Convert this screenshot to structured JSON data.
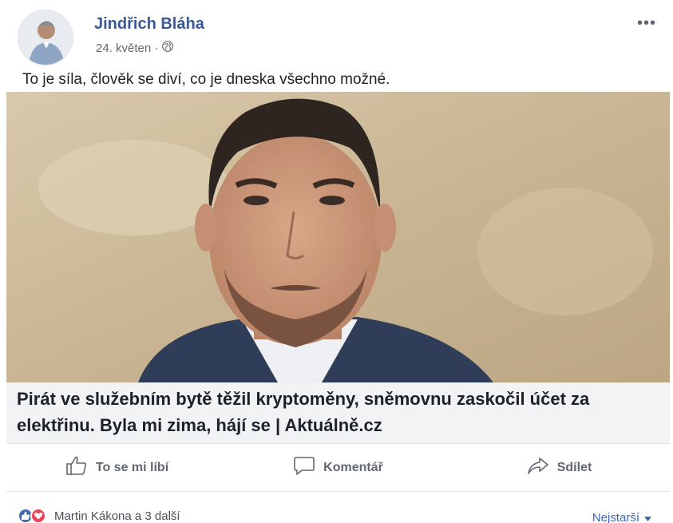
{
  "post": {
    "author": "Jindřich Bláha",
    "date": "24. květen ·",
    "privacy_icon": "globe-icon",
    "menu_label": "•••",
    "caption": "To je síla, člověk se diví, co je dneska všechno možné.",
    "link_title": "Pirát ve služebním bytě těžil kryptoměny, sněmovnu zaskočil účet za elektřinu. Byla mi zima, hájí se | Aktuálně.cz"
  },
  "actions": {
    "like_label": "To se mi líbí",
    "comment_label": "Komentář",
    "share_label": "Sdílet"
  },
  "footer": {
    "reactions_text": "Martin Kákona a 3 další",
    "sort_label": "Nejstarší"
  },
  "colors": {
    "link_blue": "#385898",
    "like_blue": "#4267b2",
    "love_red": "#f33e58",
    "link_box_bg": "#f2f3f5"
  }
}
